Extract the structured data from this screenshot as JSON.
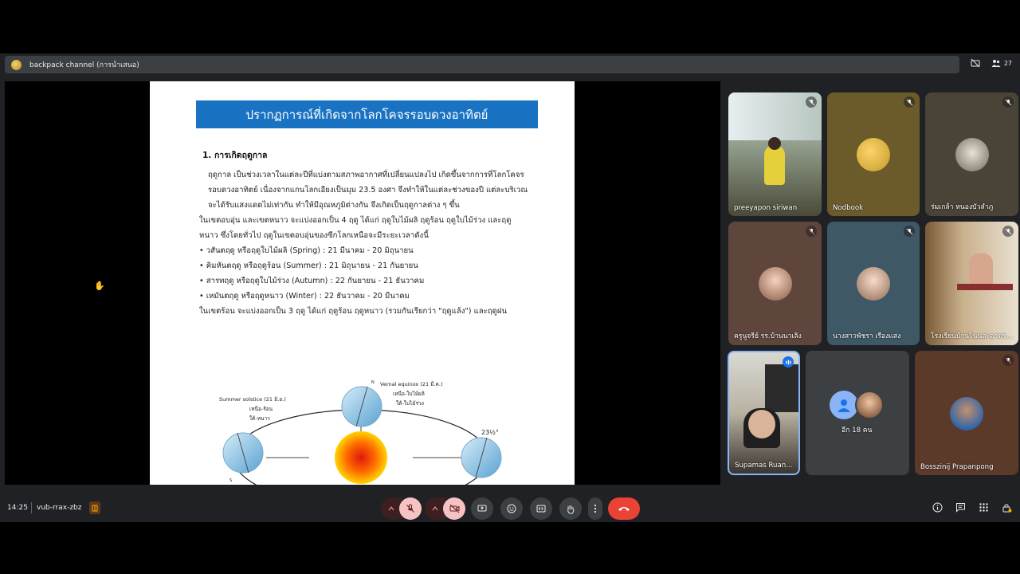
{
  "presentation": {
    "title": "backpack channel (การนำเสนอ)",
    "participant_count": "27"
  },
  "slide": {
    "title": "ปรากฏการณ์ที่เกิดจากโลกโคจรรอบดวงอาทิตย์",
    "heading": "1. การเกิดฤดูกาล",
    "lines": [
      "ฤดูกาล เป็นช่วงเวลาในแต่ละปีที่แบ่งตามสภาพอากาศที่เปลี่ยนแปลงไป เกิดขึ้นจากการที่โลกโคจร",
      "รอบดวงอาทิตย์ เนื่องจากแกนโลกเอียงเป็นมุม 23.5 องศา จึงทำให้ในแต่ละช่วงของปี แต่ละบริเวณ",
      "จะได้รับแสงแดดไม่เท่ากัน ทำให้มีอุณหภูมิต่างกัน จึงเกิดเป็นฤดูกาลต่าง ๆ ขึ้น",
      "ในเขตอบอุ่น และเขตหนาว จะแบ่งออกเป็น 4 ฤดู ได้แก่ ฤดูใบไม้ผลิ ฤดูร้อน ฤดูใบไม้ร่วง และฤดู",
      "หนาว ซึ่งโดยทั่วไป ฤดูในเขตอบอุ่นของซีกโลกเหนือจะมีระยะเวลาดังนี้",
      "• วสันตฤดู หรือฤดูใบไม้ผลิ (Spring) : 21 มีนาคม - 20 มิถุนายน",
      "• คิมหันตฤดู หรือฤดูร้อน (Summer) : 21 มิถุนายน - 21 กันยายน",
      "• สารทฤดู หรือฤดูใบไม้ร่วง (Autumn) : 22 กันยายน - 21 ธันวาคม",
      "• เหมันตฤดู หรือฤดูหนาว (Winter) : 22 ธันวาคม - 20 มีนาคม",
      "ในเขตร้อน จะแบ่งออกเป็น 3 ฤดู ได้แก่ ฤดูร้อน ฤดูหนาว (รวมกันเรียกว่า \"ฤดูแล้ง\") และฤดูฝน"
    ],
    "diagram": {
      "summer_label_1": "Summer solstice (21 มิ.ย.)",
      "summer_label_2": "เหนือ-ร้อน",
      "summer_label_3": "ใต้-หนาว",
      "vernal_label_1": "Vernal equinox (21 มี.ค.)",
      "vernal_label_2": "เหนือ-ใบไม้ผลิ",
      "vernal_label_3": "ใต้-ใบไม้ร่วง",
      "angle_label": "23½°",
      "north": "N",
      "south": "S"
    }
  },
  "participants": [
    {
      "name": "preeyapon siriwan",
      "muted": true
    },
    {
      "name": "Nodbook",
      "muted": true
    },
    {
      "name": "ร่มเกล้า หนองบัวลำภู",
      "muted": true
    },
    {
      "name": "ครูนูจรีย์ รร.บ้านนาเลิง",
      "muted": true
    },
    {
      "name": "นางสาวพัชรา เรืองแสง",
      "muted": true
    },
    {
      "name": "โรงเรียนบ้านโนนสะอาดร...",
      "muted": true
    },
    {
      "name": "Supamas Ruan...",
      "speaking": true
    },
    {
      "name": "อีก 18 คน"
    },
    {
      "name": "Bosszinij Prapanpong",
      "muted": true
    }
  ],
  "bottom": {
    "time": "14:25",
    "meeting_code": "vub-rrax-zbz"
  },
  "colors": {
    "meet_bg": "#202124",
    "slide_title_bg": "#1a73c2",
    "end_call": "#ea4335",
    "muted_control": "#f6c3c3"
  }
}
